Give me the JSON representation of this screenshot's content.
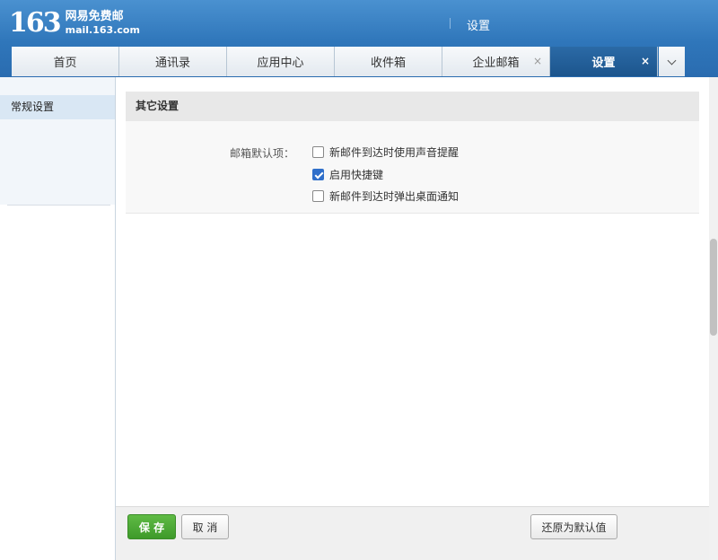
{
  "brand": {
    "logo_number": "163",
    "name": "网易免费邮",
    "domain": "mail.163.com"
  },
  "header": {
    "title": "设置"
  },
  "tabs": [
    {
      "label": "首页",
      "closable": false,
      "active": false
    },
    {
      "label": "通讯录",
      "closable": false,
      "active": false
    },
    {
      "label": "应用中心",
      "closable": false,
      "active": false
    },
    {
      "label": "收件箱",
      "closable": false,
      "active": false
    },
    {
      "label": "企业邮箱",
      "closable": true,
      "active": false
    },
    {
      "label": "设置",
      "closable": true,
      "active": true
    }
  ],
  "tab_close_glyph": "×",
  "sidebar": {
    "items": [
      {
        "label": "常规设置",
        "selected": true
      }
    ]
  },
  "section": {
    "title": "其它设置",
    "option_label": "邮箱默认项：",
    "options": [
      {
        "label": "新邮件到达时使用声音提醒",
        "checked": false
      },
      {
        "label": "启用快捷键",
        "checked": true
      },
      {
        "label": "新邮件到达时弹出桌面通知",
        "checked": false
      }
    ]
  },
  "footer": {
    "save_label": "保 存",
    "cancel_label": "取 消",
    "restore_label": "还原为默认值"
  },
  "colors": {
    "header_blue": "#2f76ba",
    "active_tab": "#1c558d",
    "save_green": "#3e9a2a",
    "checkbox_blue": "#2f6fca"
  }
}
